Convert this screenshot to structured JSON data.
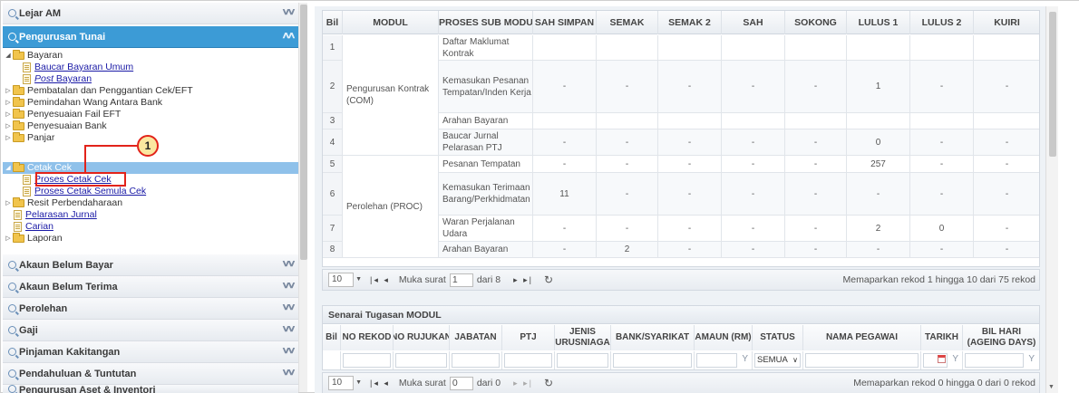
{
  "left_panel": {
    "header_lejar": "Lejar AM",
    "header_tunai": "Pengurusan Tunai",
    "tree": [
      {
        "label": "Bayaran",
        "type": "folder",
        "expanded": true
      },
      {
        "label": "Baucar Bayaran Umum",
        "type": "link"
      },
      {
        "label_italic": "Post",
        "label_rest": " Bayaran",
        "type": "link"
      },
      {
        "label": "Pembatalan dan Penggantian Cek/EFT",
        "type": "folder"
      },
      {
        "label": "Pemindahan Wang Antara Bank",
        "type": "folder"
      },
      {
        "label": "Penyesuaian Fail EFT",
        "type": "folder"
      },
      {
        "label": "Penyesuaian Bank",
        "type": "folder"
      },
      {
        "label": "Panjar",
        "type": "folder"
      },
      {
        "label": "Cetak Cek",
        "type": "folder",
        "expanded": true,
        "selected": true
      },
      {
        "label": "Proses Cetak Cek",
        "type": "link",
        "highlighted": true
      },
      {
        "label": "Proses Cetak Semula Cek",
        "type": "link"
      },
      {
        "label": "Resit Perbendaharaan",
        "type": "folder"
      },
      {
        "label": "Pelarasan Jurnal",
        "type": "link"
      },
      {
        "label": "Carian",
        "type": "link"
      },
      {
        "label": "Laporan",
        "type": "folder"
      }
    ],
    "callout_number": "1",
    "bottom_headers": [
      "Akaun Belum Bayar",
      "Akaun Belum Terima",
      "Perolehan",
      "Gaji",
      "Pinjaman Kakitangan",
      "Pendahuluan & Tuntutan",
      "Pengurusan Aset & Inventori"
    ]
  },
  "grid1": {
    "headers": [
      "Bil",
      "MODUL",
      "PROSES SUB MODUL",
      "SAH SIMPAN",
      "SEMAK",
      "SEMAK 2",
      "SAH",
      "SOKONG",
      "LULUS 1",
      "LULUS 2",
      "KUIRI"
    ],
    "modul_groups": [
      "Pengurusan Kontrak (COM)",
      "Perolehan (PROC)"
    ],
    "rows": [
      {
        "bil": "1",
        "proses": "Daftar Maklumat Kontrak",
        "vals": [
          "",
          "",
          "",
          "",
          "",
          "",
          "",
          ""
        ]
      },
      {
        "bil": "2",
        "proses": "Kemasukan Pesanan Tempatan/Inden Kerja",
        "vals": [
          "-",
          "-",
          "-",
          "-",
          "-",
          "1",
          "-",
          "-"
        ]
      },
      {
        "bil": "3",
        "proses": "Arahan Bayaran",
        "vals": [
          "",
          "",
          "",
          "",
          "",
          "",
          "",
          ""
        ]
      },
      {
        "bil": "4",
        "proses": "Baucar Jurnal Pelarasan PTJ",
        "vals": [
          "-",
          "-",
          "-",
          "-",
          "-",
          "0",
          "-",
          "-"
        ]
      },
      {
        "bil": "5",
        "proses": "Pesanan Tempatan",
        "vals": [
          "-",
          "-",
          "-",
          "-",
          "-",
          "257",
          "-",
          "-"
        ]
      },
      {
        "bil": "6",
        "proses": "Kemasukan Terimaan Barang/Perkhidmatan",
        "vals": [
          "11",
          "-",
          "-",
          "-",
          "-",
          "-",
          "-",
          "-"
        ]
      },
      {
        "bil": "7",
        "proses": "Waran Perjalanan Udara",
        "vals": [
          "-",
          "-",
          "-",
          "-",
          "-",
          "2",
          "0",
          "-"
        ]
      },
      {
        "bil": "8",
        "proses": "Arahan Bayaran",
        "vals": [
          "-",
          "2",
          "-",
          "-",
          "-",
          "-",
          "-",
          "-"
        ]
      }
    ]
  },
  "pager1": {
    "page_size": "10",
    "page_label": "Muka surat",
    "page_value": "1",
    "of_label": "dari 8",
    "info": "Memaparkan rekod 1 hingga 10 dari 75 rekod"
  },
  "grid2": {
    "title": "Senarai Tugasan MODUL",
    "headers": [
      "Bil",
      "NO REKOD",
      "NO RUJUKAN",
      "JABATAN",
      "PTJ",
      "JENIS URUSNIAGA",
      "BANK/SYARIKAT",
      "AMAUN (RM)",
      "STATUS",
      "NAMA PEGAWAI",
      "TARIKH",
      "BIL HARI (AGEING DAYS)"
    ],
    "status_filter": "SEMUA"
  },
  "pager2": {
    "page_size": "10",
    "page_label": "Muka surat",
    "page_value": "0",
    "of_label": "dari 0",
    "info": "Memaparkan rekod 0 hingga 0 dari 0 rekod"
  }
}
